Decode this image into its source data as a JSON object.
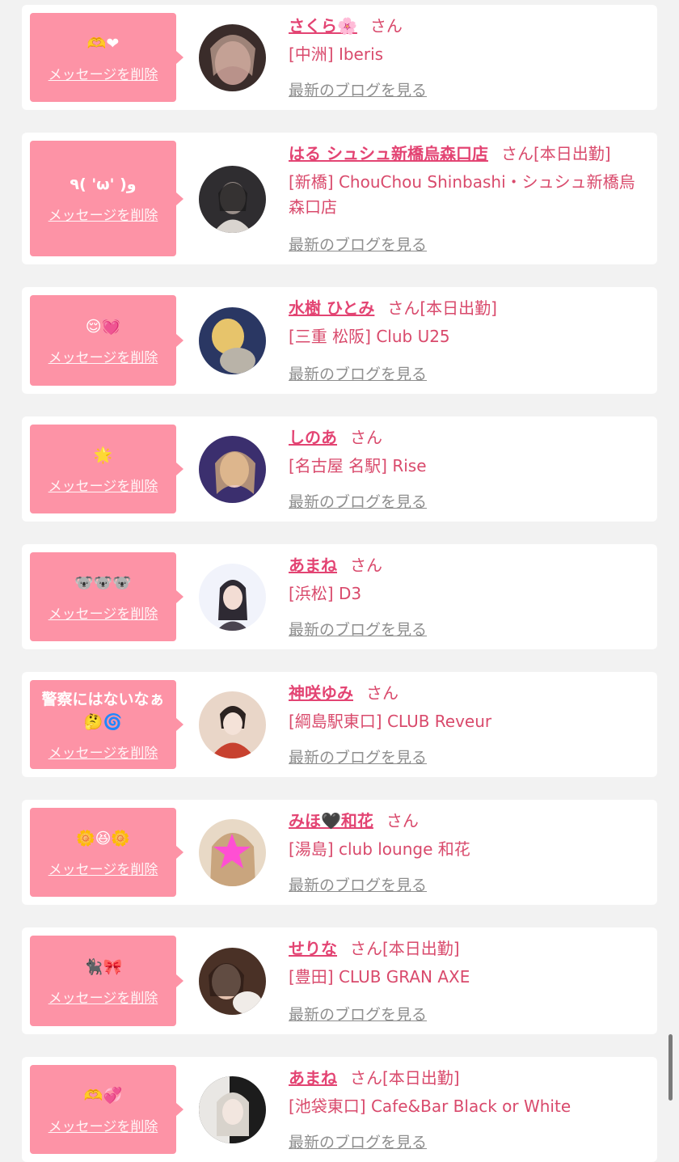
{
  "delete_label": "メッセージを削除",
  "blog_label": "最新のブログを見る",
  "san_label": "さん",
  "cards": [
    {
      "message": "🫶❤",
      "name": "さくら🌸",
      "status": "",
      "shop": "[中洲] Iberis",
      "avatar_color": "#b9928a",
      "avatar_bg": "#3a2c2a"
    },
    {
      "message": "٩( 'ω' )و",
      "name": "はる シュシュ新橋烏森口店",
      "status": "[本日出勤]",
      "shop": "[新橋] ChouChou Shinbashi・シュシュ新橋烏森口店",
      "avatar_color": "#9a8f8a",
      "avatar_bg": "#2f2d30"
    },
    {
      "message": "😌💓",
      "name": "水樹 ひとみ",
      "status": "[本日出勤]",
      "shop": "[三重 松阪] Club U25",
      "avatar_color": "#e7c46b",
      "avatar_bg": "#2a3763"
    },
    {
      "message": "🌟",
      "name": "しのあ",
      "status": "",
      "shop": "[名古屋 名駅] Rise",
      "avatar_color": "#e9c7c0",
      "avatar_bg": "#3b2f6e"
    },
    {
      "message": "🐨🐨🐨",
      "name": "あまね",
      "status": "",
      "shop": "[浜松] D3",
      "avatar_color": "#2e2a33",
      "avatar_bg": "#f1f3fb"
    },
    {
      "message": "警察にはないなぁ\n🤔🌀",
      "name": "神咲ゆみ",
      "status": "",
      "shop": "[綱島駅東口] CLUB Reveur",
      "avatar_color": "#c7412f",
      "avatar_bg": "#e9d6c8"
    },
    {
      "message": "🌼😆🌼",
      "name": "みほ🖤和花",
      "status": "",
      "shop": "[湯島] club lounge 和花",
      "avatar_color": "#ff4fd3",
      "avatar_bg": "#e8d9c6"
    },
    {
      "message": "🐈‍⬛🎀",
      "name": "せりな",
      "status": "[本日出勤]",
      "shop": "[豊田] CLUB GRAN AXE",
      "avatar_color": "#e3c1ae",
      "avatar_bg": "#4a3126"
    },
    {
      "message": "🫶💞",
      "name": "あまね",
      "status": "[本日出勤]",
      "shop": "[池袋東口] Cafe&Bar Black or White",
      "avatar_color": "#d8d3cc",
      "avatar_bg": "#1c1c1c"
    }
  ]
}
